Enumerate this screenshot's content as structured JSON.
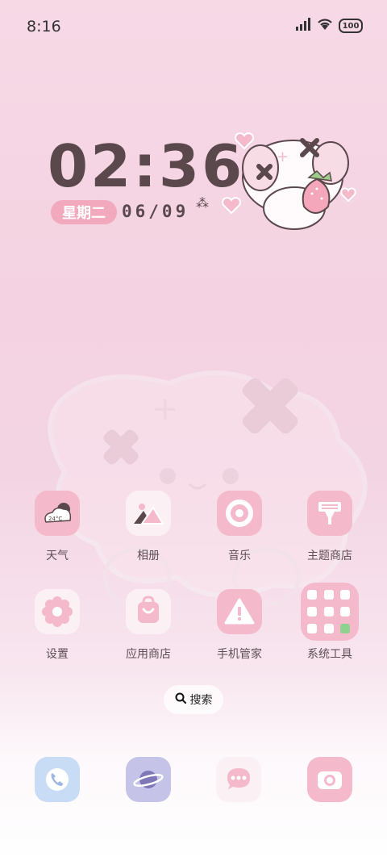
{
  "status_bar": {
    "time": "8:16",
    "battery": "100",
    "icons": [
      "signal-icon",
      "wifi-icon",
      "battery-icon"
    ]
  },
  "clock_widget": {
    "time": "02:36",
    "weekday": "星期二",
    "date": "06/09"
  },
  "apps": [
    {
      "label": "天气",
      "icon": "weather-icon",
      "badge": "24°C"
    },
    {
      "label": "相册",
      "icon": "gallery-icon"
    },
    {
      "label": "音乐",
      "icon": "music-icon"
    },
    {
      "label": "主题商店",
      "icon": "theme-store-icon"
    },
    {
      "label": "设置",
      "icon": "settings-icon"
    },
    {
      "label": "应用商店",
      "icon": "app-store-icon"
    },
    {
      "label": "手机管家",
      "icon": "security-icon"
    },
    {
      "label": "系统工具",
      "icon": "tools-folder-icon"
    }
  ],
  "search": {
    "label": "搜索"
  },
  "dock": [
    {
      "icon": "phone-icon"
    },
    {
      "icon": "browser-icon"
    },
    {
      "icon": "messages-icon"
    },
    {
      "icon": "camera-icon"
    }
  ],
  "colors": {
    "accent_pink": "#f4b9cb",
    "text_dark": "#5b484c",
    "dock_blue": "#c9dcf5",
    "dock_purple": "#c6c3e8"
  }
}
